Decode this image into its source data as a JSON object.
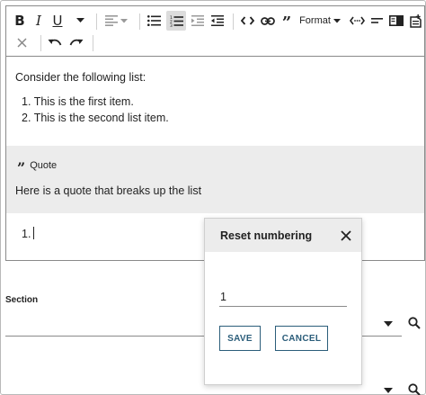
{
  "toolbar": {
    "format_label": "Format",
    "icons": [
      "bold-icon",
      "italic-icon",
      "underline-icon",
      "chevron-down-icon",
      "align-left-icon",
      "chevron-down-icon",
      "bulleted-list-icon",
      "numbered-list-icon",
      "indent-icon",
      "outdent-icon",
      "code-icon",
      "link-icon",
      "quote-icon",
      "format-dropdown",
      "code-block-icon",
      "horizontal-rule-icon",
      "panel-icon",
      "insert-after-icon",
      "clear-formatting-icon",
      "undo-icon",
      "redo-icon"
    ]
  },
  "content": {
    "intro": "Consider the following list:",
    "list_items": [
      "This is the first item.",
      "This is the second list item."
    ],
    "list_numbers": [
      "1.",
      "2."
    ],
    "quote_label": "Quote",
    "quote_text": "Here is a quote that breaks up the list",
    "new_list_number": "1."
  },
  "form": {
    "section_label": "Section"
  },
  "dialog": {
    "title": "Reset numbering",
    "value": "1",
    "save_label": "SAVE",
    "cancel_label": "CANCEL"
  },
  "colors": {
    "accent": "#2b5d7a",
    "quote_bg": "#ececec",
    "active_button": "#dcdcdc"
  }
}
